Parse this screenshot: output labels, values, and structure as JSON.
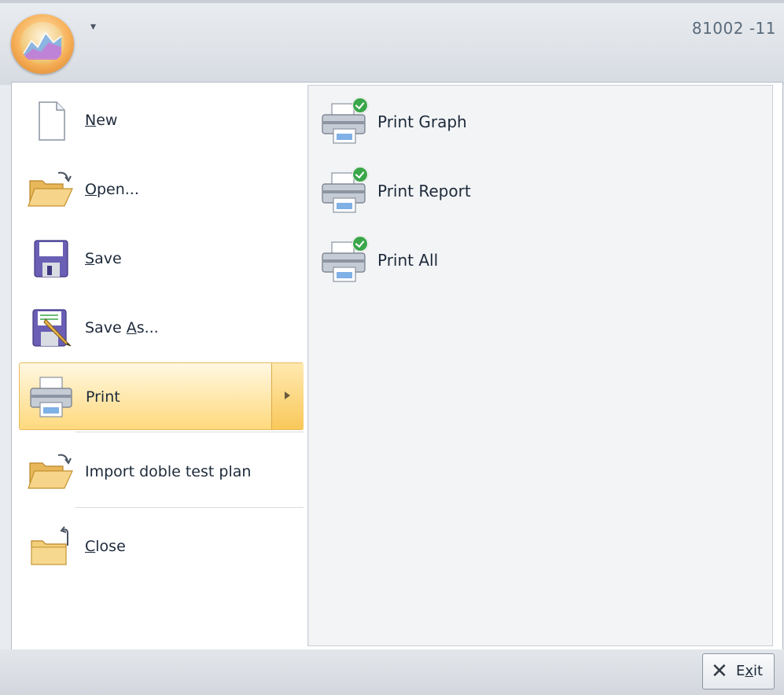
{
  "window": {
    "title_fragment": "81002  -11"
  },
  "file_menu": {
    "items": [
      {
        "id": "new",
        "label_pre": "",
        "label_accel": "N",
        "label_post": "ew",
        "icon": "new-document-icon"
      },
      {
        "id": "open",
        "label_pre": "",
        "label_accel": "O",
        "label_post": "pen...",
        "icon": "open-folder-icon"
      },
      {
        "id": "save",
        "label_pre": "",
        "label_accel": "S",
        "label_post": "ave",
        "icon": "floppy-disk-icon"
      },
      {
        "id": "save-as",
        "label_pre": "Save ",
        "label_accel": "A",
        "label_post": "s...",
        "icon": "save-as-icon"
      },
      {
        "id": "print",
        "label_pre": "Print",
        "label_accel": "",
        "label_post": "",
        "icon": "printer-icon",
        "selected": true
      },
      {
        "id": "import",
        "label_pre": "Import doble test plan",
        "label_accel": "",
        "label_post": "",
        "icon": "import-folder-icon"
      },
      {
        "id": "close",
        "label_pre": "",
        "label_accel": "C",
        "label_post": "lose",
        "icon": "close-folder-icon"
      }
    ]
  },
  "print_submenu": {
    "items": [
      {
        "label": "Print Graph",
        "icon": "printer-check-icon"
      },
      {
        "label": "Print Report",
        "icon": "printer-check-icon"
      },
      {
        "label": "Print All",
        "icon": "printer-check-icon"
      }
    ]
  },
  "footer": {
    "exit_pre": "E",
    "exit_accel": "x",
    "exit_post": "it"
  },
  "colors": {
    "selected_gradient_top": "#fff8e2",
    "selected_gradient_bottom": "#ffd97d",
    "selected_border": "#e9b95e",
    "check_green": "#3aa64a"
  }
}
